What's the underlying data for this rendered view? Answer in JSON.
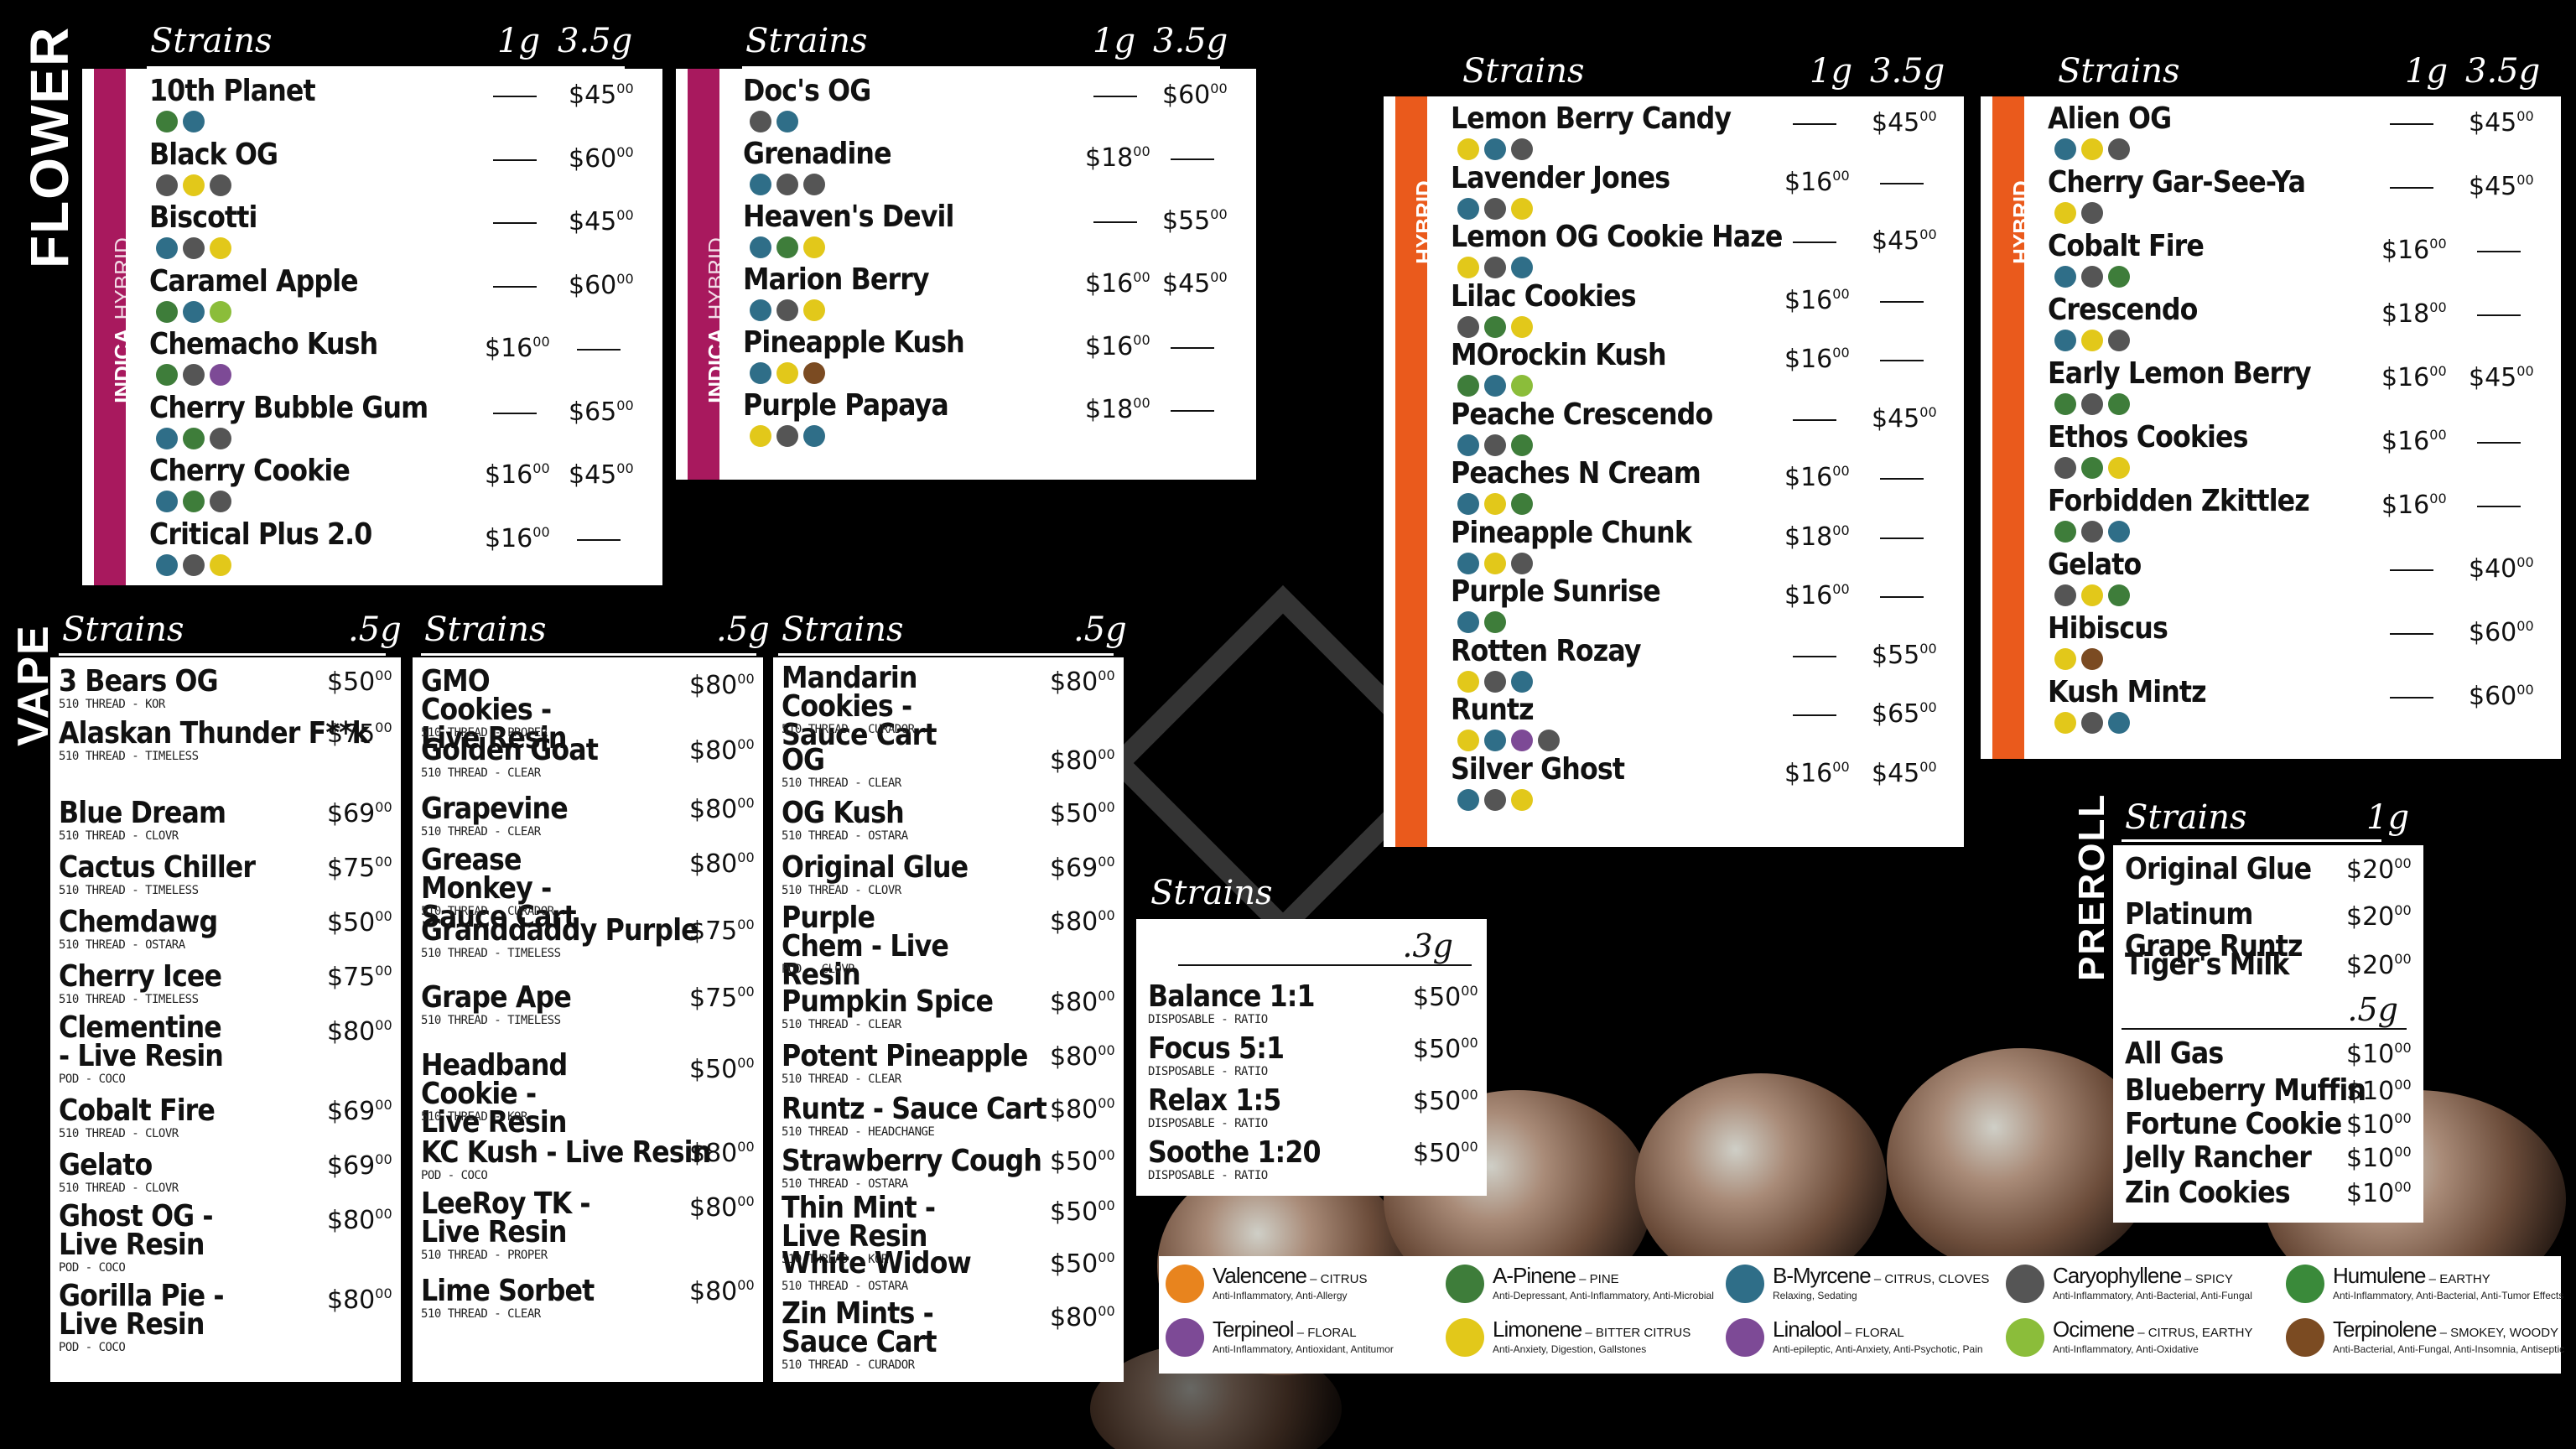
{
  "flower": {
    "title": "FLOWER",
    "head": {
      "strains": "Strains",
      "g1": "1g",
      "g35": "3.5g"
    },
    "panel1": {
      "strip": "INDICA",
      "strip2": "HYBRID",
      "items": [
        {
          "name": "10th Planet",
          "p1": "",
          "p2": "$45",
          "p2c": "00",
          "icons": [
            "pine",
            "myr"
          ]
        },
        {
          "name": "Black OG",
          "p1": "",
          "p2": "$60",
          "p2c": "00",
          "icons": [
            "car",
            "lim",
            "car"
          ]
        },
        {
          "name": "Biscotti",
          "p1": "",
          "p2": "$45",
          "p2c": "00",
          "icons": [
            "myr",
            "car",
            "lim"
          ]
        },
        {
          "name": "Caramel Apple",
          "p1": "",
          "p2": "$60",
          "p2c": "00",
          "icons": [
            "pine",
            "myr",
            "oci"
          ]
        },
        {
          "name": "Chemacho Kush",
          "p1": "$16",
          "p1c": "00",
          "p2": "",
          "icons": [
            "pine",
            "car",
            "lin"
          ]
        },
        {
          "name": "Cherry Bubble Gum",
          "p1": "",
          "p2": "$65",
          "p2c": "00",
          "icons": [
            "myr",
            "pine",
            "car"
          ]
        },
        {
          "name": "Cherry Cookie",
          "p1": "$16",
          "p1c": "00",
          "p2": "$45",
          "p2c": "00",
          "icons": [
            "myr",
            "pine",
            "car"
          ]
        },
        {
          "name": "Critical Plus 2.0",
          "p1": "$16",
          "p1c": "00",
          "p2": "",
          "icons": [
            "myr",
            "car",
            "lim"
          ]
        }
      ]
    },
    "panel2": {
      "strip": "INDICA",
      "strip2": "HYBRID",
      "items": [
        {
          "name": "Doc's OG",
          "p1": "",
          "p2": "$60",
          "p2c": "00",
          "icons": [
            "car",
            "myr"
          ]
        },
        {
          "name": "Grenadine",
          "p1": "$18",
          "p1c": "00",
          "p2": "",
          "icons": [
            "myr",
            "car",
            "car"
          ]
        },
        {
          "name": "Heaven's Devil",
          "p1": "",
          "p2": "$55",
          "p2c": "00",
          "icons": [
            "myr",
            "pine",
            "lim"
          ]
        },
        {
          "name": "Marion Berry",
          "p1": "$16",
          "p1c": "00",
          "p2": "$45",
          "p2c": "00",
          "icons": [
            "myr",
            "car",
            "lim"
          ]
        },
        {
          "name": "Pineapple Kush",
          "p1": "$16",
          "p1c": "00",
          "p2": "",
          "icons": [
            "myr",
            "lim",
            "ter"
          ]
        },
        {
          "name": "Purple Papaya",
          "p1": "$18",
          "p1c": "00",
          "p2": "",
          "icons": [
            "lim",
            "car",
            "myr"
          ]
        }
      ]
    },
    "panel3": {
      "strip": "HYBRID",
      "items": [
        {
          "name": "Lemon Berry Candy",
          "p1": "",
          "p2": "$45",
          "p2c": "00",
          "icons": [
            "lim",
            "myr",
            "car"
          ]
        },
        {
          "name": "Lavender Jones",
          "p1": "$16",
          "p1c": "00",
          "p2": "",
          "icons": [
            "myr",
            "car",
            "lim"
          ]
        },
        {
          "name": "Lemon OG Cookie Haze",
          "p1": "",
          "p2": "$45",
          "p2c": "00",
          "icons": [
            "lim",
            "car",
            "myr"
          ]
        },
        {
          "name": "Lilac Cookies",
          "p1": "$16",
          "p1c": "00",
          "p2": "",
          "icons": [
            "car",
            "pine",
            "lim"
          ]
        },
        {
          "name": "MOrockin Kush",
          "p1": "$16",
          "p1c": "00",
          "p2": "",
          "icons": [
            "pine",
            "myr",
            "oci"
          ]
        },
        {
          "name": "Peache Crescendo",
          "p1": "",
          "p2": "$45",
          "p2c": "00",
          "icons": [
            "myr",
            "car",
            "pine"
          ]
        },
        {
          "name": "Peaches N Cream",
          "p1": "$16",
          "p1c": "00",
          "p2": "",
          "icons": [
            "myr",
            "lim",
            "pine"
          ]
        },
        {
          "name": "Pineapple Chunk",
          "p1": "$18",
          "p1c": "00",
          "p2": "",
          "icons": [
            "myr",
            "lim",
            "car"
          ]
        },
        {
          "name": "Purple Sunrise",
          "p1": "$16",
          "p1c": "00",
          "p2": "",
          "icons": [
            "myr",
            "pine"
          ]
        },
        {
          "name": "Rotten Rozay",
          "p1": "",
          "p2": "$55",
          "p2c": "00",
          "icons": [
            "lim",
            "car",
            "myr"
          ]
        },
        {
          "name": "Runtz",
          "p1": "",
          "p2": "$65",
          "p2c": "00",
          "icons": [
            "lim",
            "myr",
            "lin",
            "car"
          ]
        },
        {
          "name": "Silver Ghost",
          "p1": "$16",
          "p1c": "00",
          "p2": "$45",
          "p2c": "00",
          "icons": [
            "myr",
            "car",
            "lim"
          ]
        }
      ]
    },
    "panel4": {
      "strip": "HYBRID",
      "items": [
        {
          "name": "Alien OG",
          "p1": "",
          "p2": "$45",
          "p2c": "00",
          "icons": [
            "myr",
            "lim",
            "car"
          ]
        },
        {
          "name": "Cherry Gar-See-Ya",
          "p1": "",
          "p2": "$45",
          "p2c": "00",
          "icons": [
            "lim",
            "car"
          ]
        },
        {
          "name": "Cobalt Fire",
          "p1": "$16",
          "p1c": "00",
          "p2": "",
          "icons": [
            "myr",
            "car",
            "pine"
          ]
        },
        {
          "name": "Crescendo",
          "p1": "$18",
          "p1c": "00",
          "p2": "",
          "icons": [
            "myr",
            "lim",
            "car"
          ]
        },
        {
          "name": "Early Lemon Berry",
          "p1": "$16",
          "p1c": "00",
          "p2": "$45",
          "p2c": "00",
          "icons": [
            "pine",
            "car",
            "pine"
          ]
        },
        {
          "name": "Ethos Cookies",
          "p1": "$16",
          "p1c": "00",
          "p2": "",
          "icons": [
            "car",
            "pine",
            "lim"
          ]
        },
        {
          "name": "Forbidden Zkittlez",
          "p1": "$16",
          "p1c": "00",
          "p2": "",
          "icons": [
            "pine",
            "car",
            "myr"
          ]
        },
        {
          "name": "Gelato",
          "p1": "",
          "p2": "$40",
          "p2c": "00",
          "icons": [
            "car",
            "lim",
            "pine"
          ]
        },
        {
          "name": "Hibiscus",
          "p1": "",
          "p2": "$60",
          "p2c": "00",
          "icons": [
            "lim",
            "ter"
          ]
        },
        {
          "name": "Kush Mintz",
          "p1": "",
          "p2": "$60",
          "p2c": "00",
          "icons": [
            "lim",
            "car",
            "myr"
          ]
        }
      ]
    }
  },
  "vape": {
    "title": "VAPE",
    "head": {
      "strains": "Strains",
      "g": ".5g"
    },
    "col1": [
      {
        "name": "3 Bears OG",
        "sub": "510 THREAD - KOR",
        "p": "$50",
        "c": "00"
      },
      {
        "name": "Alaskan Thunder F**k",
        "sub": "510 THREAD - TIMELESS",
        "p": "$75",
        "c": "00"
      },
      {
        "name": "Blue Dream",
        "sub": "510 THREAD - CLOVR",
        "p": "$69",
        "c": "00"
      },
      {
        "name": "Cactus Chiller",
        "sub": "510 THREAD - TIMELESS",
        "p": "$75",
        "c": "00"
      },
      {
        "name": "Chemdawg",
        "sub": "510 THREAD - OSTARA",
        "p": "$50",
        "c": "00"
      },
      {
        "name": "Cherry Icee",
        "sub": "510 THREAD - TIMELESS",
        "p": "$75",
        "c": "00"
      },
      {
        "name": "Clementine - Live Resin",
        "sub": "POD - COCO",
        "p": "$80",
        "c": "00"
      },
      {
        "name": "Cobalt Fire",
        "sub": "510 THREAD - CLOVR",
        "p": "$69",
        "c": "00"
      },
      {
        "name": "Gelato",
        "sub": "510 THREAD - CLOVR",
        "p": "$69",
        "c": "00"
      },
      {
        "name": "Ghost OG - Live Resin",
        "sub": "POD - COCO",
        "p": "$80",
        "c": "00"
      },
      {
        "name": "Gorilla Pie - Live Resin",
        "sub": "POD - COCO",
        "p": "$80",
        "c": "00"
      }
    ],
    "col2": [
      {
        "name": "GMO Cookies - Live Resin",
        "sub": "510 THREAD - PROPER",
        "p": "$80",
        "c": "00"
      },
      {
        "name": "Golden Goat",
        "sub": "510 THREAD - CLEAR",
        "p": "$80",
        "c": "00"
      },
      {
        "name": "Grapevine",
        "sub": "510 THREAD - CLEAR",
        "p": "$80",
        "c": "00"
      },
      {
        "name": "Grease Monkey - Sauce Cart",
        "sub": "510 THREAD - CURADOR",
        "p": "$80",
        "c": "00"
      },
      {
        "name": "Granddaddy Purple",
        "sub": "510 THREAD - TIMELESS",
        "p": "$75",
        "c": "00"
      },
      {
        "name": "Grape Ape",
        "sub": "510 THREAD - TIMELESS",
        "p": "$75",
        "c": "00"
      },
      {
        "name": "Headband Cookie - Live Resin",
        "sub": "510 THREAD - KOR",
        "p": "$50",
        "c": "00"
      },
      {
        "name": "KC Kush - Live Resin",
        "sub": "POD - COCO",
        "p": "$80",
        "c": "00"
      },
      {
        "name": "LeeRoy TK - Live Resin",
        "sub": "510 THREAD - PROPER",
        "p": "$80",
        "c": "00"
      },
      {
        "name": "Lime Sorbet",
        "sub": "510 THREAD - CLEAR",
        "p": "$80",
        "c": "00"
      }
    ],
    "col3": [
      {
        "name": "Mandarin Cookies - Sauce Cart",
        "sub": "510 THREAD - CURADOR",
        "p": "$80",
        "c": "00"
      },
      {
        "name": "OG",
        "sub": "510 THREAD - CLEAR",
        "p": "$80",
        "c": "00"
      },
      {
        "name": "OG Kush",
        "sub": "510 THREAD - OSTARA",
        "p": "$50",
        "c": "00"
      },
      {
        "name": "Original Glue",
        "sub": "510 THREAD - CLOVR",
        "p": "$69",
        "c": "00"
      },
      {
        "name": "Purple Chem - Live Resin",
        "sub": "POD - CLOVR",
        "p": "$80",
        "c": "00"
      },
      {
        "name": "Pumpkin Spice",
        "sub": "510 THREAD - CLEAR",
        "p": "$80",
        "c": "00"
      },
      {
        "name": "Potent Pineapple",
        "sub": "510 THREAD - CLEAR",
        "p": "$80",
        "c": "00"
      },
      {
        "name": "Runtz - Sauce Cart",
        "sub": "510 THREAD - HEADCHANGE",
        "p": "$80",
        "c": "00"
      },
      {
        "name": "Strawberry Cough",
        "sub": "510 THREAD - OSTARA",
        "p": "$50",
        "c": "00"
      },
      {
        "name": "Thin Mint - Live Resin",
        "sub": "510 THREAD - KOR",
        "p": "$50",
        "c": "00"
      },
      {
        "name": "White Widow",
        "sub": "510 THREAD - OSTARA",
        "p": "$50",
        "c": "00"
      },
      {
        "name": "Zin Mints - Sauce Cart",
        "sub": "510 THREAD - CURADOR",
        "p": "$80",
        "c": "00"
      }
    ]
  },
  "disposable": {
    "head": "Strains",
    "g": ".3g",
    "items": [
      {
        "name": "Balance 1:1",
        "sub": "DISPOSABLE - RATIO",
        "p": "$50",
        "c": "00"
      },
      {
        "name": "Focus 5:1",
        "sub": "DISPOSABLE - RATIO",
        "p": "$50",
        "c": "00"
      },
      {
        "name": "Relax 1:5",
        "sub": "DISPOSABLE - RATIO",
        "p": "$50",
        "c": "00"
      },
      {
        "name": "Soothe 1:20",
        "sub": "DISPOSABLE - RATIO",
        "p": "$50",
        "c": "00"
      }
    ]
  },
  "preroll": {
    "title": "PREROLL",
    "head": "Strains",
    "g1": "1g",
    "g2": ".5g",
    "items1": [
      {
        "name": "Original Glue",
        "p": "$20",
        "c": "00"
      },
      {
        "name": "Platinum Grape Runtz",
        "p": "$20",
        "c": "00"
      },
      {
        "name": "Tiger's Milk",
        "p": "$20",
        "c": "00"
      }
    ],
    "items2": [
      {
        "name": "All Gas",
        "p": "$10",
        "c": "00"
      },
      {
        "name": "Blueberry Muffin",
        "p": "$10",
        "c": "00"
      },
      {
        "name": "Fortune Cookie",
        "p": "$10",
        "c": "00"
      },
      {
        "name": "Jelly Rancher",
        "p": "$10",
        "c": "00"
      },
      {
        "name": "Zin Cookies",
        "p": "$10",
        "c": "00"
      }
    ]
  },
  "legend": [
    {
      "key": "val",
      "name": "Valencene",
      "note": " – CITRUS",
      "desc": "Anti-Inflammatory, Anti-Allergy",
      "color": "#e8841e",
      "icon": "orange-icon"
    },
    {
      "key": "pine",
      "name": "A-Pinene",
      "note": " – PINE",
      "desc": "Anti-Depressant, Anti-Inflammatory, Anti-Microbial",
      "color": "#3e7d3a",
      "icon": "pine-tree-icon"
    },
    {
      "key": "myr",
      "name": "B-Myrcene",
      "note": " – CITRUS, CLOVES",
      "desc": "Relaxing, Sedating",
      "color": "#2f6e88",
      "icon": "hops-icon"
    },
    {
      "key": "car",
      "name": "Caryophyllene",
      "note": " – SPICY",
      "desc": "Anti-Inflammatory, Anti-Bacterial, Anti-Fungal",
      "color": "#555555",
      "icon": "pepper-grinder-icon"
    },
    {
      "key": "hum",
      "name": "Humulene",
      "note": " – EARTHY",
      "desc": "Anti-Inflammatory, Anti-Bacterial, Anti-Tumor Effects",
      "color": "#3a8a3a",
      "icon": "hop-leaf-icon"
    },
    {
      "key": "ter",
      "name": "Terpineol",
      "note": " – FLORAL",
      "desc": "Anti-Inflammatory, Antioxidant, Antitumor",
      "color": "#7d4a96",
      "icon": "flower-icon"
    },
    {
      "key": "lim",
      "name": "Limonene",
      "note": " – BITTER CITRUS",
      "desc": "Anti-Anxiety, Digestion, Gallstones",
      "color": "#e2c81a",
      "icon": "lemon-icon"
    },
    {
      "key": "lin",
      "name": "Linalool",
      "note": " – FLORAL",
      "desc": "Anti-epileptic, Anti-Anxiety, Anti-Psychotic, Pain",
      "color": "#7d4a96",
      "icon": "lavender-icon"
    },
    {
      "key": "oci",
      "name": "Ocimene",
      "note": " – CITRUS, EARTHY",
      "desc": "Anti-Inflammatory, Anti-Oxidative",
      "color": "#8bbd3a",
      "icon": "basil-leaf-icon"
    },
    {
      "key": "tpn",
      "name": "Terpinolene",
      "note": " – SMOKEY, WOODY",
      "desc": "Anti-Bacterial, Anti-Fungal, Anti-Insomnia, Antiseptic",
      "color": "#7b4b22",
      "icon": "wood-stump-icon"
    }
  ],
  "colors": {
    "indica_strip": "#a8195e",
    "hybrid_strip": "#ea5a1c",
    "panel": "#ffffff",
    "background": "#000000"
  }
}
